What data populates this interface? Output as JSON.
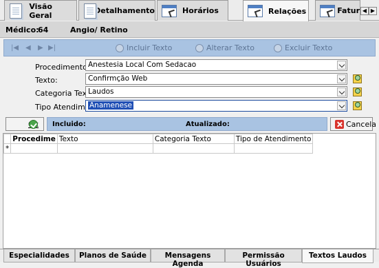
{
  "top_tabs": [
    {
      "label": "Visão Geral",
      "icon": "document-icon"
    },
    {
      "label": "Detalhamento",
      "icon": "document-icon"
    },
    {
      "label": "Horários",
      "icon": "window-cursor-icon"
    },
    {
      "label": "Relações",
      "icon": "window-cursor-icon",
      "active": true
    },
    {
      "label": "Fatur",
      "icon": "window-cursor-icon"
    }
  ],
  "header": {
    "medico_label": "Médico:",
    "medico_code": "64",
    "medico_name": "Angio/ Retino"
  },
  "navbar": {
    "nav_glyphs": [
      "|◀",
      "◀",
      "▶",
      "▶|"
    ],
    "incluir": "Incluir Texto",
    "alterar": "Alterar Texto",
    "excluir": "Excluir Texto"
  },
  "form": {
    "procedimento": {
      "label": "Procedimento:",
      "value": "Anestesia Local Com Sedacao"
    },
    "texto": {
      "label": "Texto:",
      "value": "Confirmção Web"
    },
    "categoria": {
      "label": "Categoria Texto:",
      "value": "Laudos"
    },
    "tipo": {
      "label": "Tipo Atendim.:",
      "value": "Anamenese"
    }
  },
  "status": {
    "ok": "Ok",
    "incluido": "Incluido:",
    "atualizado": "Atualizado:",
    "cancela": "Cancela"
  },
  "grid": {
    "columns": [
      "Procedime",
      "Texto",
      "Categoria Texto",
      "Tipo de Atendimento"
    ],
    "new_row_marker": "*"
  },
  "bottom_tabs": [
    {
      "label": "Especialidades"
    },
    {
      "label": "Planos de Saúde"
    },
    {
      "label": "Mensagens Agenda"
    },
    {
      "label": "Permissão Usuários"
    },
    {
      "label": "Textos Laudos",
      "active": true
    }
  ],
  "colors": {
    "accent_bar": "#a9c3e2",
    "selection": "#1f4fb5"
  }
}
